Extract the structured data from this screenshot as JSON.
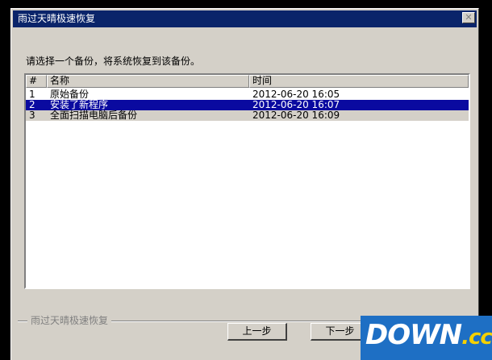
{
  "window": {
    "title": "雨过天晴极速恢复",
    "close_icon": "close-icon"
  },
  "prompt": "请选择一个备份，将系统恢复到该备份。",
  "list": {
    "columns": {
      "num": "#",
      "name": "名称",
      "time": "时间"
    },
    "rows": [
      {
        "num": "1",
        "name": "原始备份",
        "time": "2012-06-20 16:05"
      },
      {
        "num": "2",
        "name": "安装了新程序",
        "time": "2012-06-20 16:07"
      },
      {
        "num": "3",
        "name": "全面扫描电脑后备份",
        "time": "2012-06-20 16:09"
      }
    ],
    "selected_row": "2"
  },
  "footer": {
    "group_label": "雨过天晴极速恢复",
    "prev_label": "上一步",
    "next_label": "下一步"
  },
  "watermark": {
    "text": "DOWN",
    "suffix": ".cc"
  },
  "colors": {
    "title_bar": "#0a246a",
    "selection": "#0a0aa0",
    "face": "#d4d0c8"
  }
}
